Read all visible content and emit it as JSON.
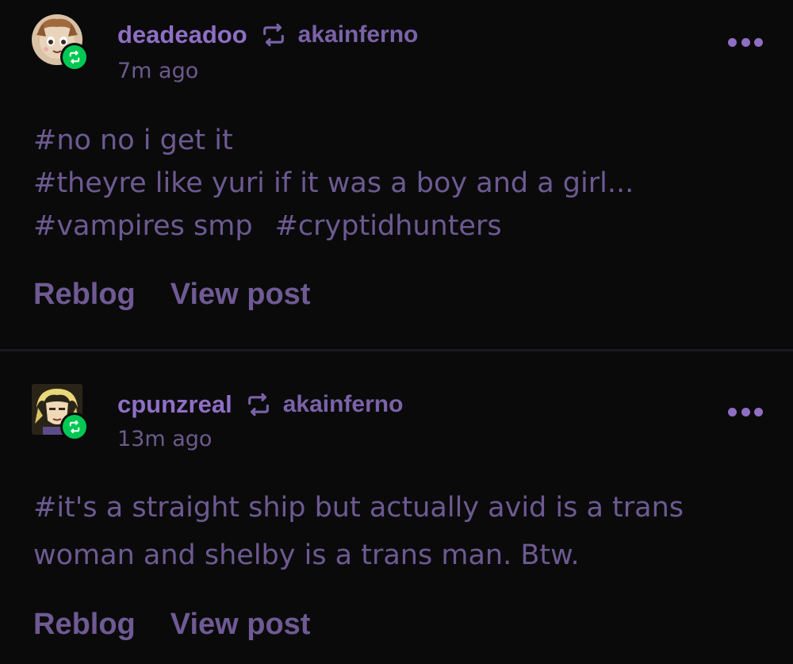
{
  "colors": {
    "background": "#0a0a0b",
    "username": "#8f6fc4",
    "text": "#6d5a91",
    "badge": "#00c853",
    "divider": "#1c1b1f"
  },
  "posts": [
    {
      "username": "deadeadoo",
      "source": "akainferno",
      "time": "7m ago",
      "tags": [
        "#no no i get it",
        "#theyre like yuri if it was a boy and a girl...",
        "#vampires smp",
        "#cryptidhunters"
      ],
      "actions": {
        "reblog": "Reblog",
        "view": "View post"
      }
    },
    {
      "username": "cpunzreal",
      "source": "akainferno",
      "time": "13m ago",
      "tags": [
        "#it's a straight ship but actually avid is a trans woman and shelby is a trans man. Btw."
      ],
      "actions": {
        "reblog": "Reblog",
        "view": "View post"
      }
    }
  ]
}
